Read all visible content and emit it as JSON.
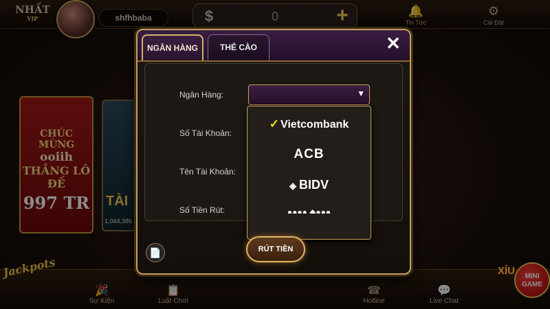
{
  "topbar": {
    "logo_top": "NHẤT",
    "logo_bottom": "VIP",
    "username": "shfhbaba",
    "currency_symbol": "$",
    "balance": "0",
    "add_symbol": "+",
    "news_label": "Tin Tức",
    "settings_label": "Cài Đặt"
  },
  "background": {
    "banner_line1": "CHÚC MỪNG",
    "banner_line2": "ooiih",
    "banner_line3": "THẮNG LÔ ĐỀ",
    "banner_line4": "997 TR",
    "game_title": "TÀI",
    "game_amount": "1,044,386",
    "jackpots": "Jackpots",
    "xiu": "XỈU",
    "minigame_line1": "MINI",
    "minigame_line2": "GAME"
  },
  "bottombar": {
    "items": [
      {
        "label": "Sự Kiện",
        "icon": "party-icon"
      },
      {
        "label": "Luật Chơi",
        "icon": "rules-icon"
      },
      {
        "label": "Hotline",
        "icon": "phone-icon"
      },
      {
        "label": "Live Chat",
        "icon": "chat-icon"
      }
    ]
  },
  "dialog": {
    "tab_bank": "NGÂN HÀNG",
    "tab_card": "THẺ CÀO",
    "close_symbol": "✕",
    "label_bank": "Ngân Hàng:",
    "label_account_number": "Số Tài Khoản:",
    "label_account_name": "Tên Tài Khoản:",
    "label_amount": "Số Tiền Rút:",
    "select_value": "",
    "caret": "▼",
    "bank_options": [
      "Vietcombank",
      "ACB",
      "BIDV"
    ],
    "submit_label": "RÚT TIỀN"
  }
}
